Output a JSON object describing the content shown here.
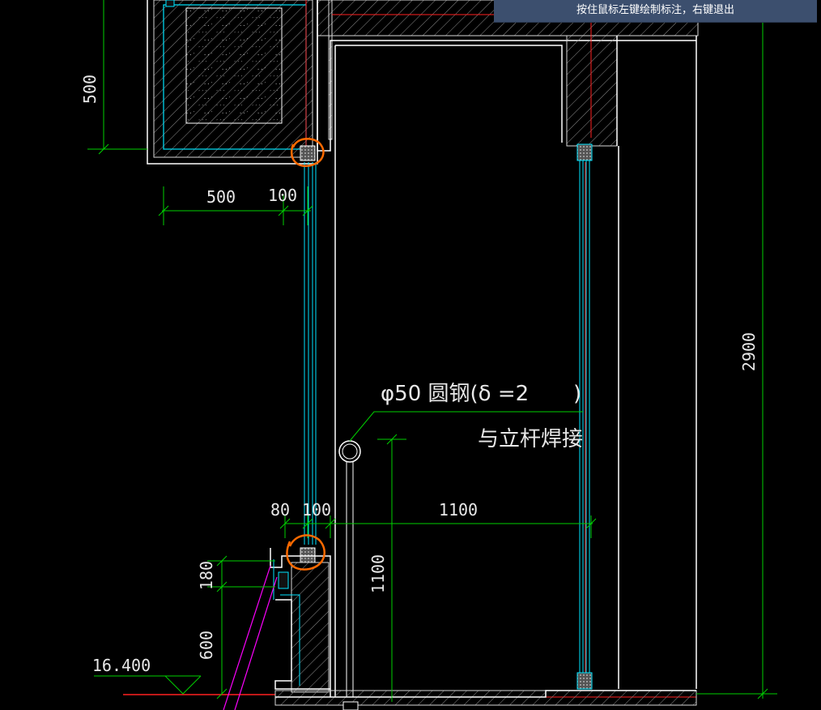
{
  "tooltip": "按住鼠标左键绘制标注，右键退出",
  "dimensions": {
    "d500_vertical": "500",
    "d500_horizontal": "500",
    "d100_top": "100",
    "d80": "80",
    "d100_bottom": "100",
    "d1100_horizontal": "1100",
    "d1100_vertical": "1100",
    "d180": "180",
    "d600": "600",
    "d2900": "2900"
  },
  "elevation": "16.400",
  "annotation": {
    "line1": "φ50 圆钢(δ =2",
    "line1_close": ")",
    "line2": "与立杆焊接"
  },
  "colors": {
    "wall": "#ffffff",
    "hatch": "#9a9a9a",
    "glass": "#00e5ff",
    "dimension": "#00d000",
    "axis": "#ff2020",
    "markup": "#ff6a00",
    "magenta": "#ff00ff"
  }
}
